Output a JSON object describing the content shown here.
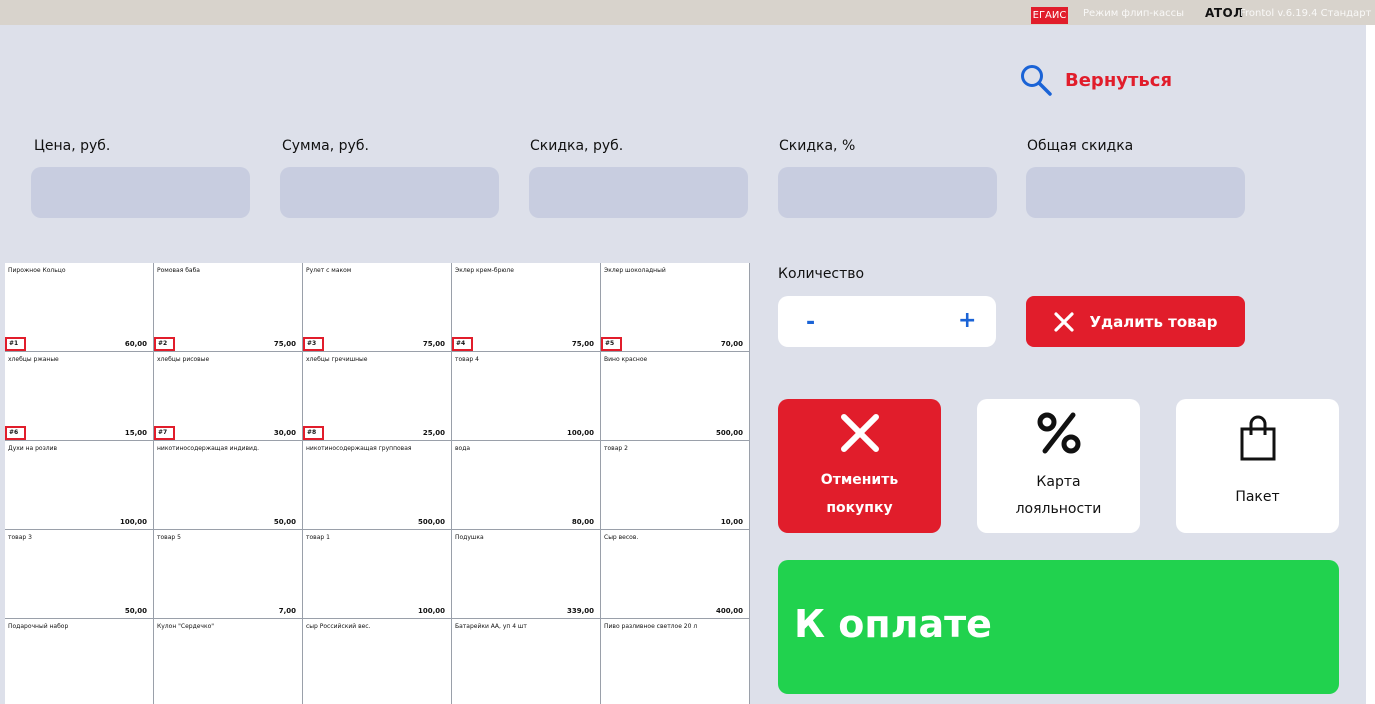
{
  "topbar": {
    "egais": "ЕГАИС",
    "mode": "Режим флип-кассы",
    "brand": "ATOЛ",
    "version": "Frontol v.6.19.4 Стандарт"
  },
  "back_label": "Вернуться",
  "fields": [
    {
      "label": "Цена, руб."
    },
    {
      "label": "Сумма, руб."
    },
    {
      "label": "Скидка, руб."
    },
    {
      "label": "Скидка, %"
    },
    {
      "label": "Общая скидка"
    }
  ],
  "products": [
    {
      "name": "Пирожное Кольцо",
      "price": "60,00",
      "tag": "#1"
    },
    {
      "name": "Ромовая баба",
      "price": "75,00",
      "tag": "#2"
    },
    {
      "name": "Рулет с маком",
      "price": "75,00",
      "tag": "#3"
    },
    {
      "name": "Эклер крем-брюле",
      "price": "75,00",
      "tag": "#4"
    },
    {
      "name": "Эклер шоколадный",
      "price": "70,00",
      "tag": "#5"
    },
    {
      "name": "хлебцы ржаные",
      "price": "15,00",
      "tag": "#6"
    },
    {
      "name": "хлебцы рисовые",
      "price": "30,00",
      "tag": "#7"
    },
    {
      "name": "хлебцы гречишные",
      "price": "25,00",
      "tag": "#8"
    },
    {
      "name": "товар 4",
      "price": "100,00",
      "tag": ""
    },
    {
      "name": "Вино красное",
      "price": "500,00",
      "tag": ""
    },
    {
      "name": "Духи на розлив",
      "price": "100,00",
      "tag": ""
    },
    {
      "name": "никотиносодержащая индивид.",
      "price": "50,00",
      "tag": ""
    },
    {
      "name": "никотиносодержащая групповая",
      "price": "500,00",
      "tag": ""
    },
    {
      "name": "вода",
      "price": "80,00",
      "tag": ""
    },
    {
      "name": "товар 2",
      "price": "10,00",
      "tag": ""
    },
    {
      "name": "товар 3",
      "price": "50,00",
      "tag": ""
    },
    {
      "name": "товар 5",
      "price": "7,00",
      "tag": ""
    },
    {
      "name": "товар 1",
      "price": "100,00",
      "tag": ""
    },
    {
      "name": "Подушка",
      "price": "339,00",
      "tag": ""
    },
    {
      "name": "Сыр весов.",
      "price": "400,00",
      "tag": ""
    },
    {
      "name": "Подарочный набор",
      "price": "",
      "tag": ""
    },
    {
      "name": "Кулон \"Сердечко\"",
      "price": "",
      "tag": ""
    },
    {
      "name": "сыр Российский вес.",
      "price": "",
      "tag": ""
    },
    {
      "name": "Батарейки АА, уп 4 шт",
      "price": "",
      "tag": ""
    },
    {
      "name": "Пиво разливное светлое 20 л",
      "price": "",
      "tag": ""
    }
  ],
  "quantity": {
    "label": "Количество",
    "minus": "-",
    "plus": "+"
  },
  "delete_label": "Удалить товар",
  "actions": {
    "cancel": {
      "line1": "Отменить",
      "line2": "покупку"
    },
    "loyalty": {
      "line1": "Карта",
      "line2": "лояльности"
    },
    "bag": {
      "line1": "Пакет"
    }
  },
  "pay_label": "К оплате",
  "colors": {
    "accent_red": "#e11d2b",
    "accent_blue": "#1a63d6",
    "pay_green": "#21d24e"
  }
}
